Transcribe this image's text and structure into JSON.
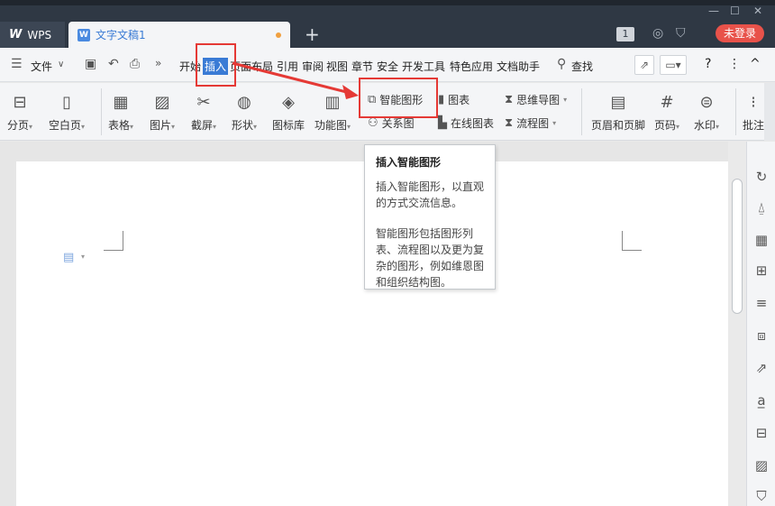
{
  "titlebar": {
    "app_tab": "WPS",
    "doc_tab": "文字文稿1",
    "badge": "1",
    "login": "未登录",
    "new_tab": "+",
    "minimize": "—",
    "maximize": "☐",
    "close": "✕"
  },
  "menubar": {
    "file": "文件",
    "items": [
      "开始",
      "插入",
      "页面布局",
      "引用",
      "审阅",
      "视图",
      "章节",
      "安全",
      "开发工具",
      "特色应用",
      "文档助手"
    ],
    "search": "查找",
    "help": "?",
    "more": "⋮",
    "collapse": "^"
  },
  "ribbon": {
    "buttons": [
      {
        "label": "分页",
        "icon": "page-break-icon"
      },
      {
        "label": "空白页",
        "icon": "blank-page-icon"
      },
      {
        "label": "表格",
        "icon": "table-icon"
      },
      {
        "label": "图片",
        "icon": "picture-icon"
      },
      {
        "label": "截屏",
        "icon": "screenshot-icon"
      },
      {
        "label": "形状",
        "icon": "shape-icon"
      },
      {
        "label": "图标库",
        "icon": "icon-library-icon"
      },
      {
        "label": "功能图",
        "icon": "function-chart-icon"
      }
    ],
    "small": {
      "smart_art": "智能图形",
      "relation": "关系图",
      "chart": "图表",
      "online_chart": "在线图表",
      "mind_map": "思维导图",
      "flow_chart": "流程图"
    },
    "right_buttons": [
      {
        "label": "页眉和页脚",
        "icon": "header-footer-icon"
      },
      {
        "label": "页码",
        "icon": "page-number-icon"
      },
      {
        "label": "水印",
        "icon": "watermark-icon"
      },
      {
        "label": "批注",
        "icon": "comment-icon"
      }
    ]
  },
  "tooltip": {
    "title": "插入智能图形",
    "para1": "插入智能图形，以直观的方式交流信息。",
    "para2": "智能图形包括图形列表、流程图以及更为复杂的图形，例如维恩图和组织结构图。"
  },
  "colors": {
    "titlebar_bg": "#2f3844",
    "accent": "#3a7bd5",
    "login_red": "#e8524a",
    "highlight_red": "#e53935"
  }
}
